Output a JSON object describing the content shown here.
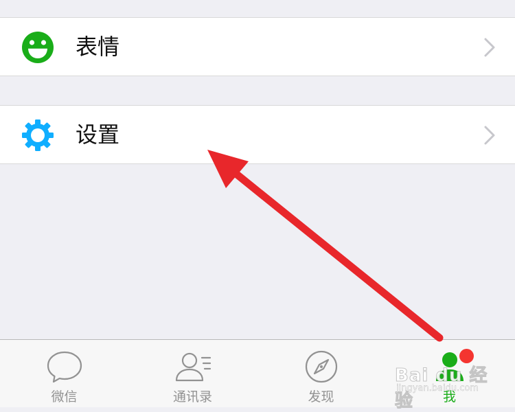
{
  "menu": {
    "items": [
      {
        "label": "表情",
        "icon": "smiley-icon",
        "icon_color": "#1aad19"
      },
      {
        "label": "设置",
        "icon": "gear-icon",
        "icon_color": "#10aeff"
      }
    ]
  },
  "tabbar": {
    "tabs": [
      {
        "label": "微信",
        "icon": "chat-bubble-icon",
        "active": false
      },
      {
        "label": "通讯录",
        "icon": "contacts-icon",
        "active": false
      },
      {
        "label": "发现",
        "icon": "compass-icon",
        "active": false
      },
      {
        "label": "我",
        "icon": "me-icon",
        "active": true,
        "badge": true
      }
    ],
    "active_color": "#1aad19",
    "inactive_color": "#929292",
    "badge_color": "#f43530"
  },
  "annotation": {
    "arrow_color": "#e8272b"
  },
  "watermark": {
    "main": "Bai du 经验",
    "sub": "jingyan.baidu.com"
  }
}
